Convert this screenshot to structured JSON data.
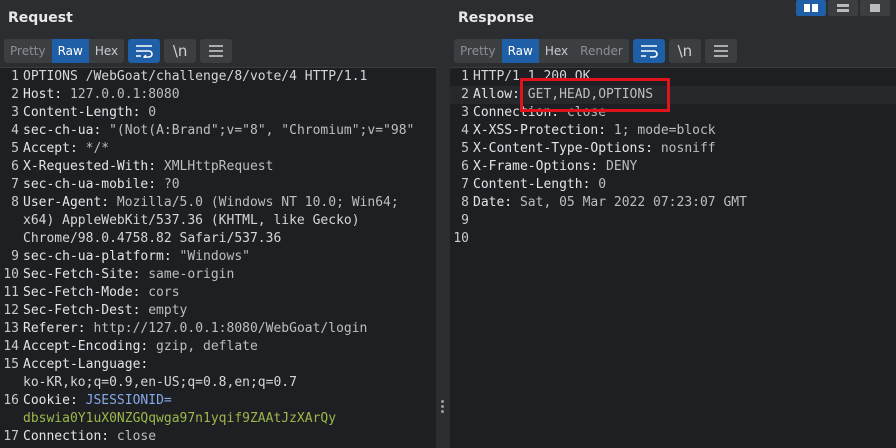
{
  "request": {
    "title": "Request",
    "tabs": [
      "Pretty",
      "Raw",
      "Hex"
    ],
    "active_tab": "Raw",
    "newline_label": "\\n",
    "lines": [
      {
        "n": "1",
        "text": "OPTIONS /WebGoat/challenge/8/vote/4 HTTP/1.1"
      },
      {
        "n": "2",
        "key": "Host:",
        "val": " 127.0.0.1:8080"
      },
      {
        "n": "3",
        "key": "Content-Length:",
        "val": " 0"
      },
      {
        "n": "4",
        "key": "sec-ch-ua:",
        "val": " \"(Not(A:Brand\";v=\"8\", \"Chromium\";v=\"98\""
      },
      {
        "n": "5",
        "key": "Accept:",
        "val": " */*"
      },
      {
        "n": "6",
        "key": "X-Requested-With:",
        "val": " XMLHttpRequest"
      },
      {
        "n": "7",
        "key": "sec-ch-ua-mobile:",
        "val": " ?0"
      },
      {
        "n": "8",
        "key": "User-Agent:",
        "val": " Mozilla/5.0 (Windows NT 10.0; Win64;"
      },
      {
        "n": "",
        "text": "x64) AppleWebKit/537.36 (KHTML, like Gecko)"
      },
      {
        "n": "",
        "text": "Chrome/98.0.4758.82 Safari/537.36"
      },
      {
        "n": "9",
        "key": "sec-ch-ua-platform:",
        "val": " \"Windows\""
      },
      {
        "n": "10",
        "key": "Sec-Fetch-Site:",
        "val": " same-origin"
      },
      {
        "n": "11",
        "key": "Sec-Fetch-Mode:",
        "val": " cors"
      },
      {
        "n": "12",
        "key": "Sec-Fetch-Dest:",
        "val": " empty"
      },
      {
        "n": "13",
        "key": "Referer:",
        "val": " http://127.0.0.1:8080/WebGoat/login"
      },
      {
        "n": "14",
        "key": "Accept-Encoding:",
        "val": " gzip, deflate"
      },
      {
        "n": "15",
        "key": "Accept-Language:",
        "val": ""
      },
      {
        "n": "",
        "text": "ko-KR,ko;q=0.9,en-US;q=0.8,en;q=0.7"
      },
      {
        "n": "16",
        "key": "Cookie:",
        "cookie_name": " JSESSIONID="
      },
      {
        "n": "",
        "cookie_val": "dbswia0Y1uX0NZGQqwga97n1yqif9ZAAtJzXArQy"
      },
      {
        "n": "17",
        "key": "Connection:",
        "val": " close"
      }
    ]
  },
  "response": {
    "title": "Response",
    "tabs": [
      "Pretty",
      "Raw",
      "Hex",
      "Render"
    ],
    "active_tab": "Raw",
    "newline_label": "\\n",
    "lines": [
      {
        "n": "1",
        "text": "HTTP/1.1 200 OK"
      },
      {
        "n": "2",
        "key": "Allow:",
        "val": " GET,HEAD,OPTIONS"
      },
      {
        "n": "3",
        "key": "Connection:",
        "val": " close"
      },
      {
        "n": "4",
        "key": "X-XSS-Protection:",
        "val": " 1; mode=block"
      },
      {
        "n": "5",
        "key": "X-Content-Type-Options:",
        "val": " nosniff"
      },
      {
        "n": "6",
        "key": "X-Frame-Options:",
        "val": " DENY"
      },
      {
        "n": "7",
        "key": "Content-Length:",
        "val": " 0"
      },
      {
        "n": "8",
        "key": "Date:",
        "val": " Sat, 05 Mar 2022 07:23:07 GMT"
      },
      {
        "n": "9",
        "text": ""
      },
      {
        "n": "10",
        "text": ""
      }
    ]
  },
  "colors": {
    "accent": "#1f5fa8",
    "highlight_box": "#e0141d",
    "cookie_name": "#86a9e8",
    "cookie_value": "#9bb84a"
  },
  "icons": [
    "wrap-icon",
    "newline-icon",
    "menu-icon",
    "layout-side-by-side-icon",
    "layout-horizontal-icon",
    "layout-vertical-icon"
  ]
}
